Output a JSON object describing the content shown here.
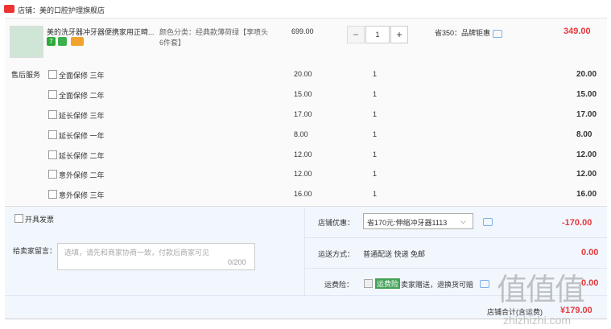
{
  "store": {
    "name": "店铺：美的口腔护理旗舰店"
  },
  "product": {
    "title": "美的洗牙器冲牙器便携家用正畸...",
    "tag_number": "7",
    "spec_label": "颜色分类：",
    "spec_value": "经典款薄荷绿【享喷头6件套】",
    "unit_price": "699.00",
    "quantity": "1",
    "promo": "省350：品牌钜惠",
    "total": "349.00"
  },
  "after_sales": {
    "label": "售后服务",
    "items": [
      {
        "label": "全面保修 三年",
        "price": "20.00",
        "qty": "1",
        "sum": "20.00"
      },
      {
        "label": "全面保修 二年",
        "price": "15.00",
        "qty": "1",
        "sum": "15.00"
      },
      {
        "label": "延长保修 三年",
        "price": "17.00",
        "qty": "1",
        "sum": "17.00"
      },
      {
        "label": "延长保修 一年",
        "price": "8.00",
        "qty": "1",
        "sum": "8.00"
      },
      {
        "label": "延长保修 二年",
        "price": "12.00",
        "qty": "1",
        "sum": "12.00"
      },
      {
        "label": "意外保修 二年",
        "price": "12.00",
        "qty": "1",
        "sum": "12.00"
      },
      {
        "label": "意外保修 三年",
        "price": "16.00",
        "qty": "1",
        "sum": "16.00"
      }
    ]
  },
  "invoice": {
    "label": "开具发票"
  },
  "note": {
    "label": "给卖家留言：",
    "placeholder": "选填，请先和商家协商一致，付款后商家可见",
    "count": "0/200"
  },
  "shop_discount": {
    "label": "店铺优惠：",
    "selected": "省170元:伸缩冲牙器1113",
    "amount": "-170.00"
  },
  "shipping": {
    "label": "运送方式：",
    "value": "普通配送 快递 免邮",
    "fee": "0.00"
  },
  "insurance": {
    "label": "运费险：",
    "badge": "运费险",
    "text": "卖家赠送，退换货可赔",
    "fee": "0.00"
  },
  "summary": {
    "label": "店铺合计(含运费)",
    "total": "¥179.00"
  },
  "watermark": {
    "logo": "值值值",
    "site": "zhizhizhi.com"
  }
}
